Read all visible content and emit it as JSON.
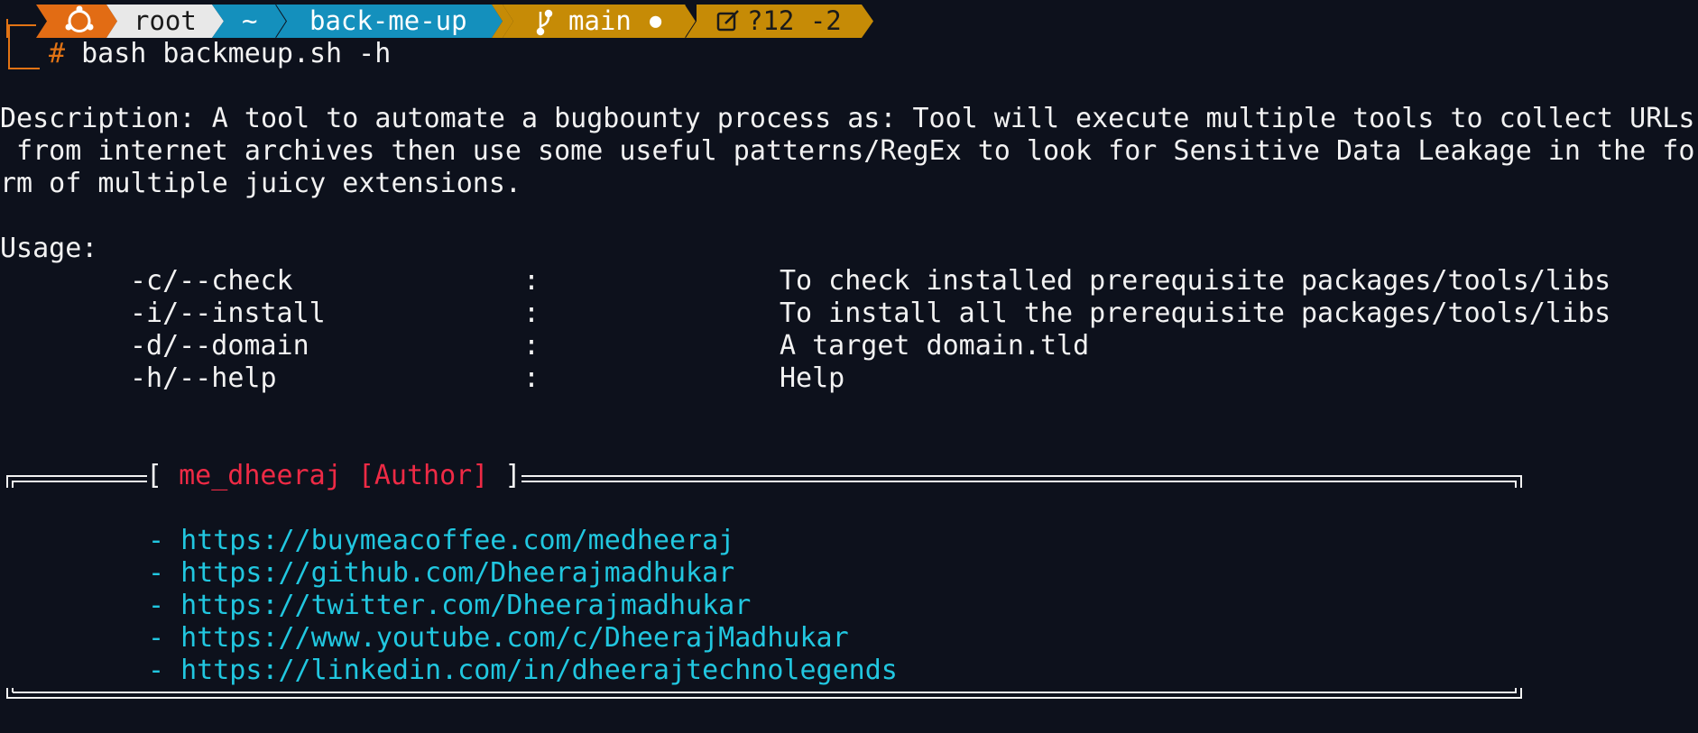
{
  "prompt": {
    "user": "root",
    "home": "~",
    "dir": "back-me-up",
    "branch": "main",
    "branch_dot": "●",
    "git_status": "?12 -2",
    "symbol": "#",
    "command": "bash backmeup.sh -h"
  },
  "colors": {
    "background": "#0d111c",
    "os_segment": "#e26c14",
    "user_segment": "#e8e8e8",
    "path_segment": "#1490bd",
    "git_segment": "#c68b06",
    "link": "#21c7e0",
    "author": "#ee2a45"
  },
  "output": {
    "description_lines": [
      "Description: A tool to automate a bugbounty process as: Tool will execute multiple tools to collect URLs",
      " from internet archives then use some useful patterns/RegEx to look for Sensitive Data Leakage in the fo",
      "rm of multiple juicy extensions."
    ],
    "usage_label": "Usage:",
    "options": [
      {
        "flag": "-c/--check",
        "sep": ":",
        "desc": "To check installed prerequisite packages/tools/libs"
      },
      {
        "flag": "-i/--install",
        "sep": ":",
        "desc": "To install all the prerequisite packages/tools/libs"
      },
      {
        "flag": "-d/--domain",
        "sep": ":",
        "desc": "A target domain.tld"
      },
      {
        "flag": "-h/--help",
        "sep": ":",
        "desc": "Help"
      }
    ],
    "author_open": "[ ",
    "author_name": "me_dheeraj",
    "author_tag": "[Author]",
    "author_close": " ]",
    "links": [
      "https://buymeacoffee.com/medheeraj",
      "https://github.com/Dheerajmadhukar",
      "https://twitter.com/Dheerajmadhukar",
      "https://www.youtube.com/c/DheerajMadhukar",
      "https://linkedin.com/in/dheerajtechnolegends"
    ],
    "link_bullet": "-"
  }
}
